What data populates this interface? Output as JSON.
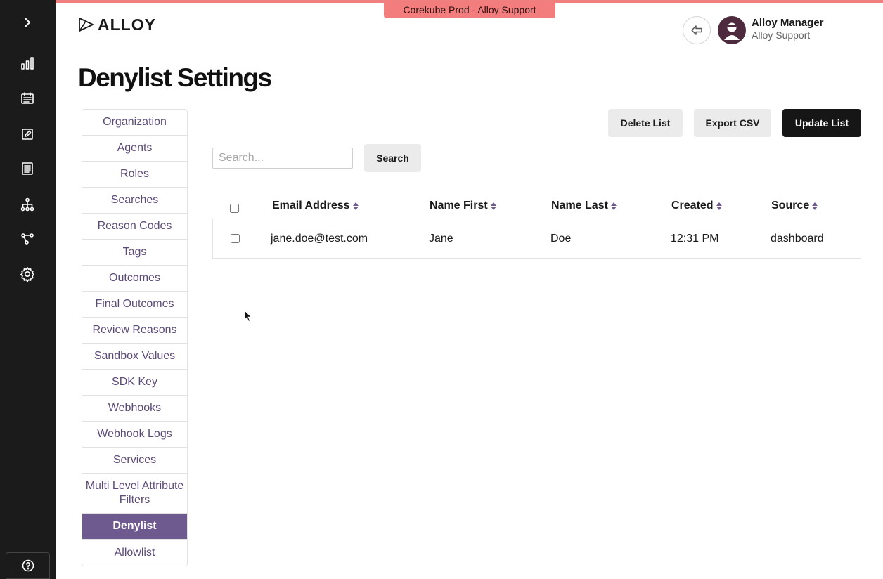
{
  "env_tag": "Corekube Prod - Alloy Support",
  "logo": {
    "text": "ALLOY"
  },
  "user": {
    "name": "Alloy Manager",
    "org": "Alloy Support"
  },
  "page": {
    "title": "Denylist Settings"
  },
  "rail_icons": [
    "chevron-right-icon",
    "bar-chart-icon",
    "calendar-icon",
    "edit-icon",
    "document-icon",
    "hierarchy-icon",
    "workflow-icon",
    "gear-icon",
    "help-icon"
  ],
  "side_nav": {
    "items": [
      {
        "label": "Organization"
      },
      {
        "label": "Agents"
      },
      {
        "label": "Roles"
      },
      {
        "label": "Searches"
      },
      {
        "label": "Reason Codes"
      },
      {
        "label": "Tags"
      },
      {
        "label": "Outcomes"
      },
      {
        "label": "Final Outcomes"
      },
      {
        "label": "Review Reasons"
      },
      {
        "label": "Sandbox Values"
      },
      {
        "label": "SDK Key"
      },
      {
        "label": "Webhooks"
      },
      {
        "label": "Webhook Logs"
      },
      {
        "label": "Services"
      },
      {
        "label": "Multi Level Attribute Filters"
      },
      {
        "label": "Denylist",
        "active": true
      },
      {
        "label": "Allowlist"
      }
    ]
  },
  "toolbar": {
    "delete_label": "Delete List",
    "export_label": "Export CSV",
    "update_label": "Update List"
  },
  "search": {
    "placeholder": "Search...",
    "value": "",
    "button_label": "Search"
  },
  "table": {
    "columns": [
      "Email Address",
      "Name First",
      "Name Last",
      "Created",
      "Source"
    ],
    "rows": [
      {
        "email": "jane.doe@test.com",
        "first": "Jane",
        "last": "Doe",
        "created": "12:31 PM",
        "source": "dashboard",
        "checked": false
      }
    ]
  },
  "colors": {
    "rail_bg": "#1b1b1b",
    "accent": "#6e5a8f",
    "env_tag_bg": "#f37c7c",
    "primary_button": "#161616"
  }
}
